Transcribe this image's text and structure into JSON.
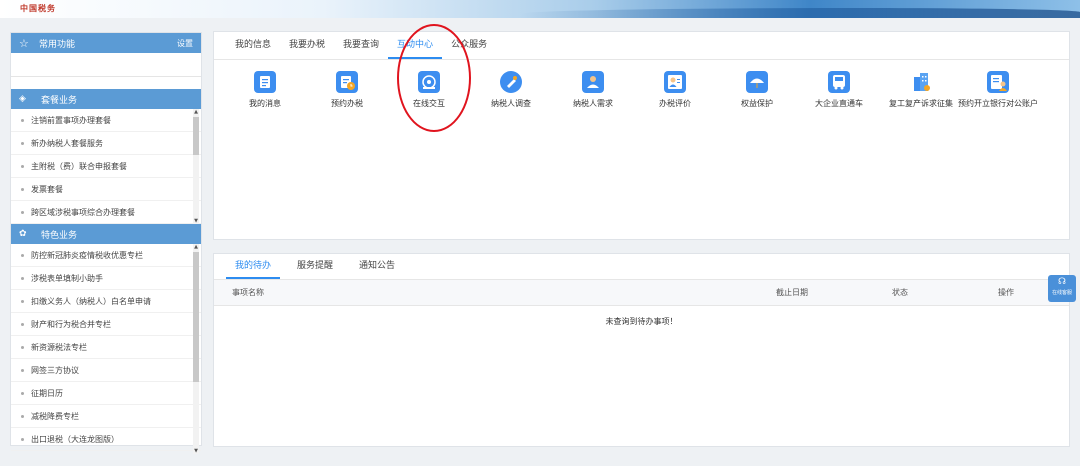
{
  "banner": {
    "logo": "中国税务"
  },
  "sidebar": {
    "header": {
      "label": "常用功能",
      "settings": "设置"
    },
    "package": {
      "title": "套餐业务",
      "items": [
        "注销前置事项办理套餐",
        "新办纳税人套餐服务",
        "主附税（费）联合申报套餐",
        "发票套餐",
        "跨区域涉税事项综合办理套餐"
      ]
    },
    "special": {
      "title": "特色业务",
      "items": [
        "防控新冠肺炎疫情税收优惠专栏",
        "涉税表单填制小助手",
        "扣缴义务人（纳税人）白名单申请",
        "财产和行为税合并专栏",
        "新资源税法专栏",
        "网签三方协议",
        "征期日历",
        "减税降费专栏",
        "出口退税（大连龙图版）"
      ]
    }
  },
  "main_tabs": [
    "我的信息",
    "我要办税",
    "我要查询",
    "互动中心",
    "公众服务"
  ],
  "active_main_tab": "互动中心",
  "interactive_icons": [
    {
      "label": "我的消息",
      "icon": "message-doc-icon",
      "color": "#3d8ef0"
    },
    {
      "label": "预约办税",
      "icon": "appointment-doc-icon",
      "color": "#3d8ef0"
    },
    {
      "label": "在线交互",
      "icon": "online-chat-icon",
      "color": "#3d8ef0"
    },
    {
      "label": "纳税人调查",
      "icon": "survey-pen-icon",
      "color": "#3d8ef0"
    },
    {
      "label": "纳税人需求",
      "icon": "user-demand-icon",
      "color": "#3d8ef0"
    },
    {
      "label": "办税评价",
      "icon": "rating-user-icon",
      "color": "#3d8ef0"
    },
    {
      "label": "权益保护",
      "icon": "umbrella-protect-icon",
      "color": "#3d8ef0"
    },
    {
      "label": "大企业直通车",
      "icon": "bus-icon",
      "color": "#3d8ef0"
    },
    {
      "label": "复工复产诉求征集",
      "icon": "building-icon",
      "color": "#3d8ef0"
    },
    {
      "label": "预约开立银行对公账户",
      "icon": "bank-account-user-icon",
      "color": "#3d8ef0"
    }
  ],
  "todo_tabs": [
    "我的待办",
    "服务提醒",
    "通知公告"
  ],
  "active_todo_tab": "我的待办",
  "todo_table": {
    "columns": [
      "事项名称",
      "截止日期",
      "状态",
      "操作"
    ],
    "empty_text": "未查询到待办事项！"
  },
  "float_button": {
    "label": "在线客服"
  },
  "colors": {
    "accent": "#2d8cf0",
    "sidebar_header": "#5b9bd5",
    "highlight": "#e0141e"
  }
}
